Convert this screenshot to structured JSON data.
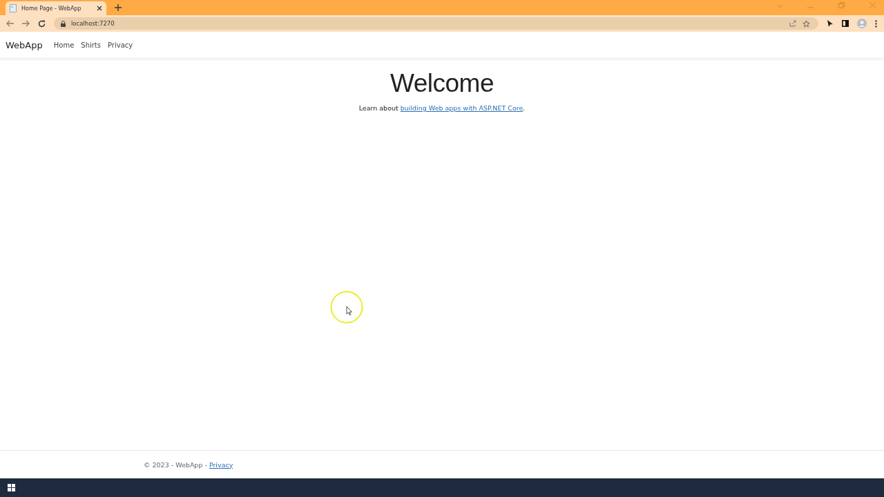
{
  "browser": {
    "tab": {
      "title": "Home Page - WebApp",
      "selected": true
    },
    "address": "localhost:7270"
  },
  "navbar": {
    "brand": "WebApp",
    "links": [
      "Home",
      "Shirts",
      "Privacy"
    ]
  },
  "main": {
    "heading": "Welcome",
    "lead": {
      "before": "Learn about ",
      "link": "building Web apps with ASP.NET Core",
      "after": "."
    }
  },
  "footer": {
    "text": "© 2023 - WebApp - ",
    "link": "Privacy"
  }
}
